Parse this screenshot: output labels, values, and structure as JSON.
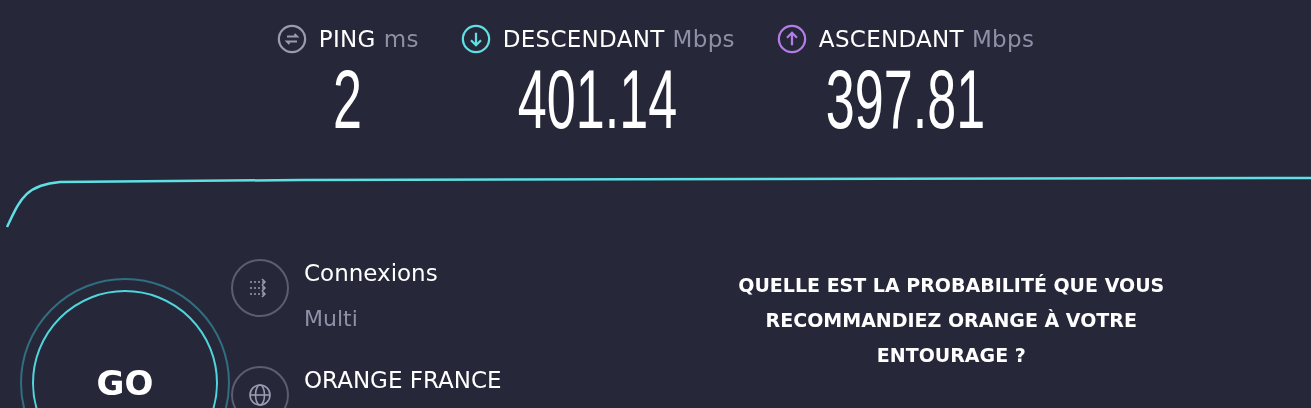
{
  "metrics": [
    {
      "kind": "ping",
      "label": "PING",
      "unit": "ms",
      "value": "2",
      "color": "#9a9bb0"
    },
    {
      "kind": "download",
      "label": "DESCENDANT",
      "unit": "Mbps",
      "value": "401.14",
      "color": "#5fe0e3"
    },
    {
      "kind": "upload",
      "label": "ASCENDANT",
      "unit": "Mbps",
      "value": "397.81",
      "color": "#b27ee6"
    }
  ],
  "go_button": {
    "label": "GO"
  },
  "details": [
    {
      "kind": "connections",
      "title": "Connexions",
      "subtitle": "Multi"
    },
    {
      "kind": "provider",
      "title": "ORANGE FRANCE"
    }
  ],
  "survey": {
    "question": "QUELLE EST LA PROBABILITÉ QUE VOUS RECOMMANDIEZ ORANGE À VOTRE ENTOURAGE ?"
  }
}
